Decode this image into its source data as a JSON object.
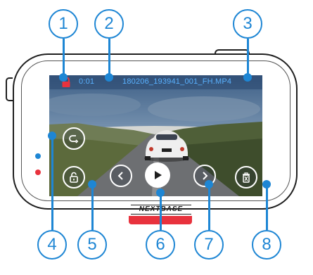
{
  "player": {
    "timecode": "0:01",
    "filename": "180206_193941_001_FH.MP4"
  },
  "brand_text": "NEXTBASE",
  "callouts": [
    "1",
    "2",
    "3",
    "4",
    "5",
    "6",
    "7",
    "8"
  ],
  "controls": {
    "back": "back-arrow-icon",
    "protect": "unlock-icon",
    "previous": "chevron-left-icon",
    "play": "play-icon",
    "next": "chevron-right-icon",
    "delete": "trash-icon"
  },
  "colors": {
    "callout_blue": "#1e86d4",
    "text_blue": "#5ab2ff",
    "lock_red": "#e8323d",
    "led_blue": "#1e86d4",
    "led_red": "#e8323d"
  }
}
